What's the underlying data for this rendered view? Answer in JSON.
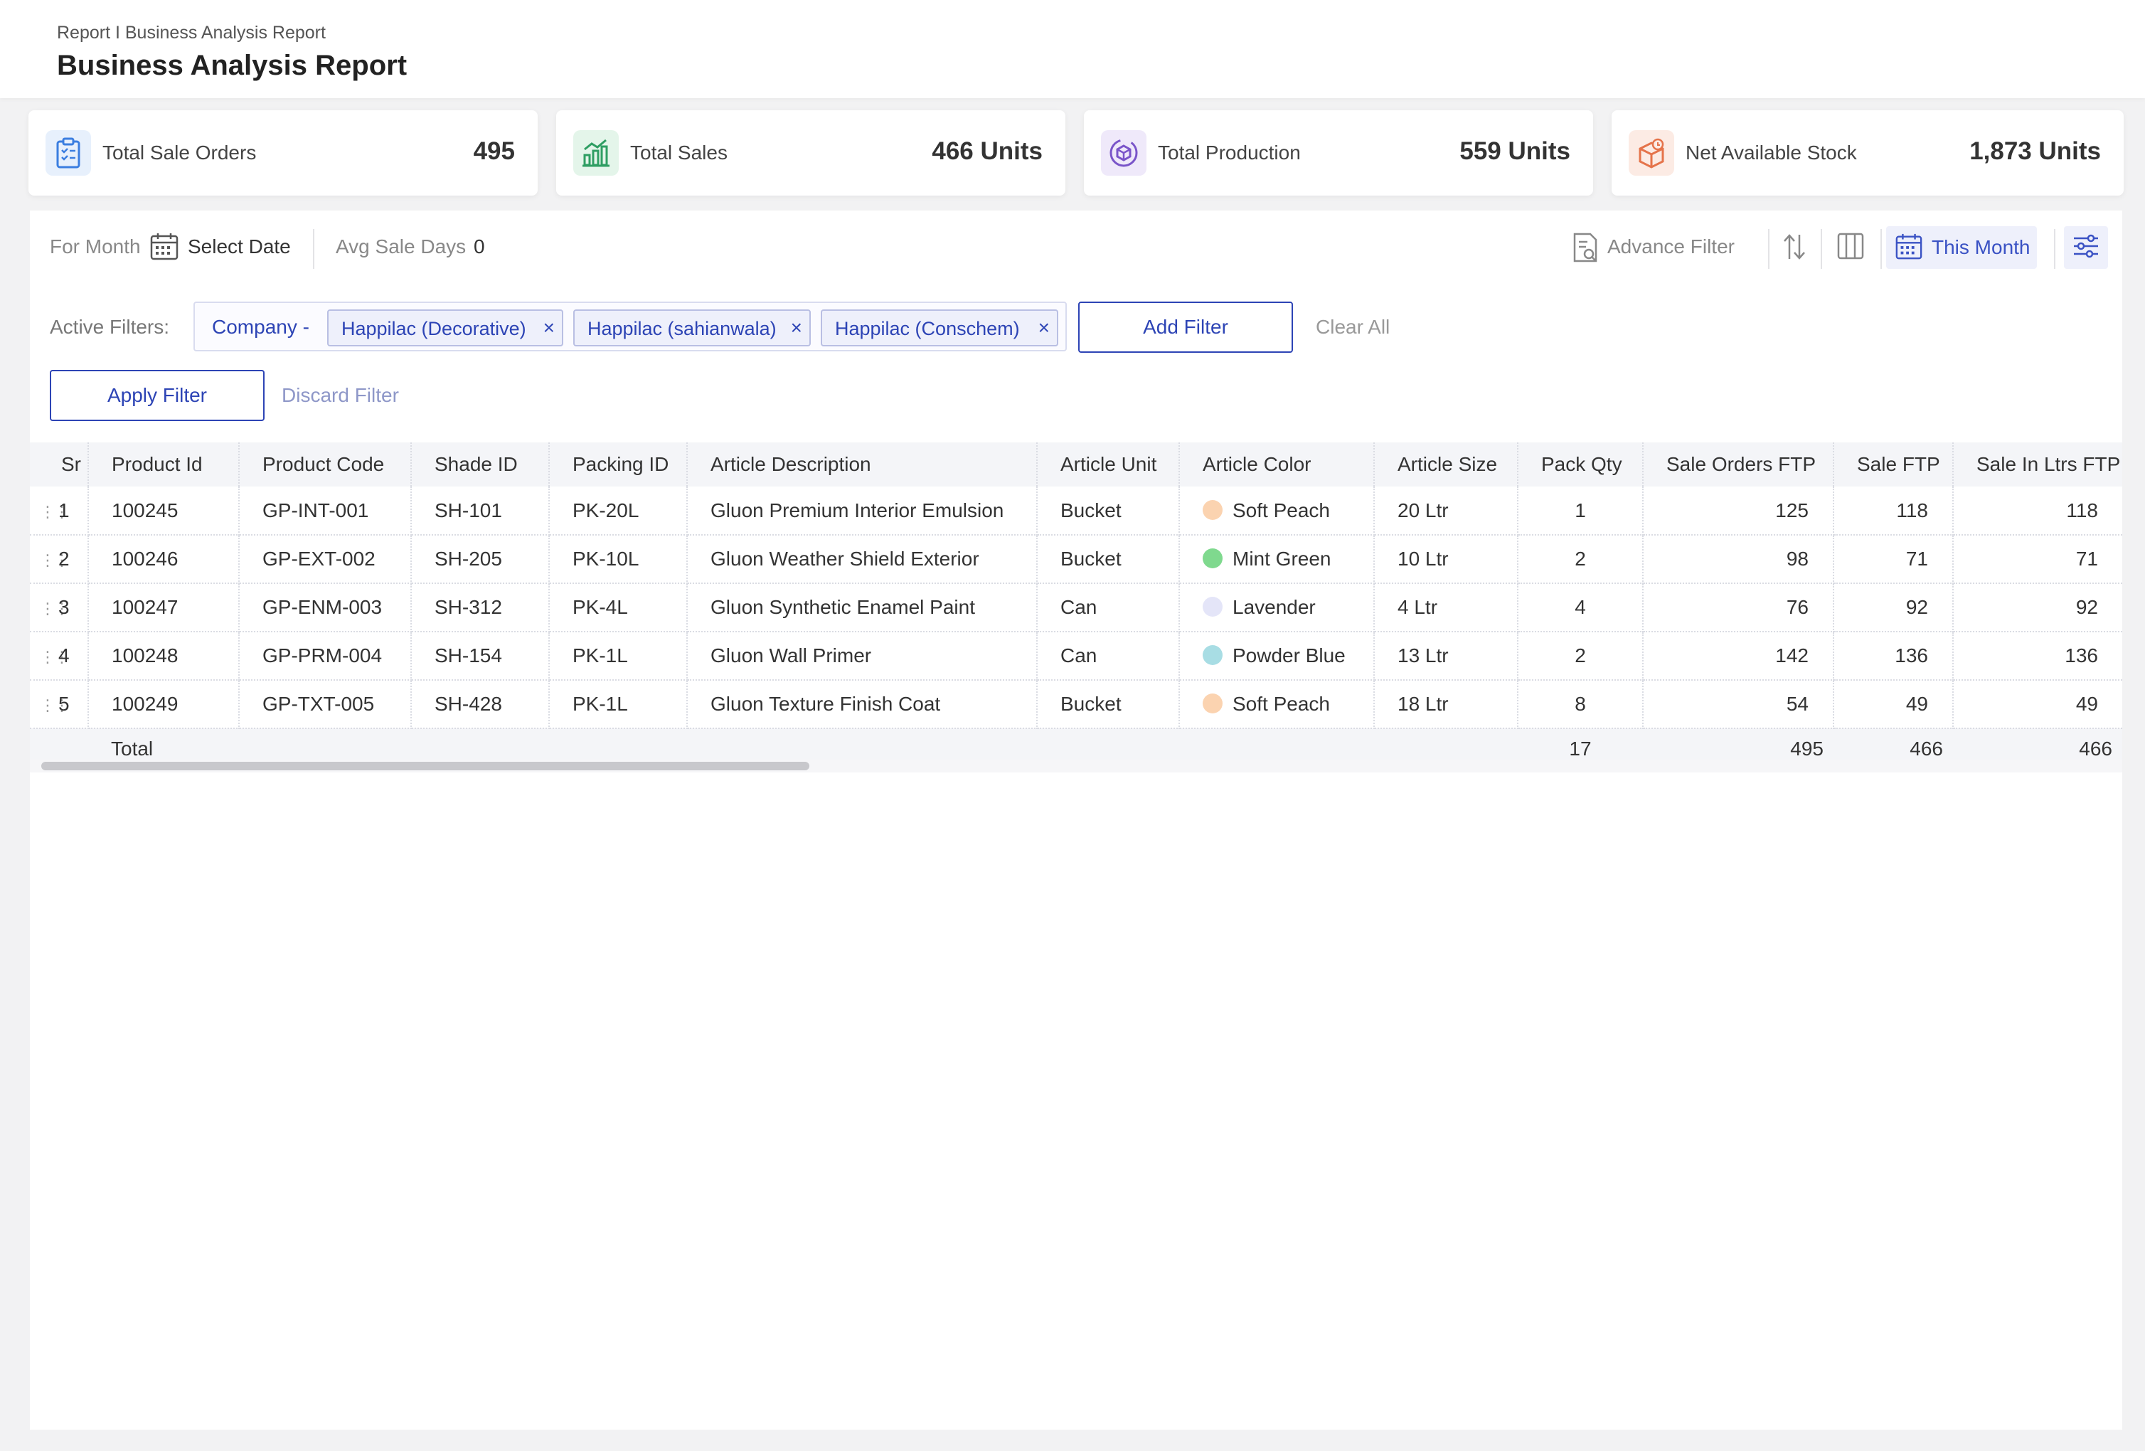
{
  "header": {
    "breadcrumb": "Report I Business Analysis Report",
    "title": "Business Analysis Report"
  },
  "stats": [
    {
      "label": "Total Sale Orders",
      "value": "495",
      "icon": "clipboard-icon",
      "color": "#3b7ee0"
    },
    {
      "label": "Total Sales",
      "value": "466 Units",
      "icon": "bar-chart-icon",
      "color": "#2f9e63"
    },
    {
      "label": "Total Production",
      "value": "559 Units",
      "icon": "production-cube-icon",
      "color": "#7a55c9"
    },
    {
      "label": "Net Available Stock",
      "value": "1,873 Units",
      "icon": "stock-box-icon",
      "color": "#e5734a"
    }
  ],
  "toolbar": {
    "for_month_label": "For Month",
    "select_date": "Select Date",
    "avg_sale_days_label": "Avg Sale Days",
    "avg_sale_days_value": "0",
    "advance_filter": "Advance Filter",
    "this_month": "This Month"
  },
  "filters": {
    "active_label": "Active Filters:",
    "group_prefix": "Company -",
    "chips": [
      "Happilac (Decorative)",
      "Happilac (sahianwala)",
      "Happilac (Conschem)"
    ],
    "add_filter": "Add Filter",
    "clear_all": "Clear All",
    "apply_filter": "Apply Filter",
    "discard_filter": "Discard Filter"
  },
  "table": {
    "columns": [
      "Sr",
      "Product Id",
      "Product Code",
      "Shade ID",
      "Packing ID",
      "Article Description",
      "Article Unit",
      "Article Color",
      "Article Size",
      "Pack Qty",
      "Sale Orders FTP",
      "Sale FTP",
      "Sale In Ltrs FTP"
    ],
    "rows": [
      {
        "sr": "1",
        "product_id": "100245",
        "product_code": "GP-INT-001",
        "shade_id": "SH-101",
        "packing_id": "PK-20L",
        "description": "Gluon Premium Interior Emulsion",
        "unit": "Bucket",
        "color_name": "Soft Peach",
        "color_hex": "#fbd3b0",
        "size": "20 Ltr",
        "pack_qty": "1",
        "sale_orders_ftp": "125",
        "sale_ftp": "118",
        "sale_ltrs_ftp": "118"
      },
      {
        "sr": "2",
        "product_id": "100246",
        "product_code": "GP-EXT-002",
        "shade_id": "SH-205",
        "packing_id": "PK-10L",
        "description": "Gluon Weather Shield Exterior",
        "unit": "Bucket",
        "color_name": "Mint Green",
        "color_hex": "#7fd98e",
        "size": "10 Ltr",
        "pack_qty": "2",
        "sale_orders_ftp": "98",
        "sale_ftp": "71",
        "sale_ltrs_ftp": "71"
      },
      {
        "sr": "3",
        "product_id": "100247",
        "product_code": "GP-ENM-003",
        "shade_id": "SH-312",
        "packing_id": "PK-4L",
        "description": "Gluon Synthetic Enamel Paint",
        "unit": "Can",
        "color_name": "Lavender",
        "color_hex": "#e4e5f8",
        "size": "4 Ltr",
        "pack_qty": "4",
        "sale_orders_ftp": "76",
        "sale_ftp": "92",
        "sale_ltrs_ftp": "92"
      },
      {
        "sr": "4",
        "product_id": "100248",
        "product_code": "GP-PRM-004",
        "shade_id": "SH-154",
        "packing_id": "PK-1L",
        "description": "Gluon Wall Primer",
        "unit": "Can",
        "color_name": "Powder Blue",
        "color_hex": "#a8dde4",
        "size": "13 Ltr",
        "pack_qty": "2",
        "sale_orders_ftp": "142",
        "sale_ftp": "136",
        "sale_ltrs_ftp": "136"
      },
      {
        "sr": "5",
        "product_id": "100249",
        "product_code": "GP-TXT-005",
        "shade_id": "SH-428",
        "packing_id": "PK-1L",
        "description": "Gluon Texture Finish Coat",
        "unit": "Bucket",
        "color_name": "Soft Peach",
        "color_hex": "#fbd3b0",
        "size": "18 Ltr",
        "pack_qty": "8",
        "sale_orders_ftp": "54",
        "sale_ftp": "49",
        "sale_ltrs_ftp": "49"
      }
    ],
    "total": {
      "label": "Total",
      "pack_qty": "17",
      "sale_orders_ftp": "495",
      "sale_ftp": "466",
      "sale_ltrs_ftp": "466"
    }
  }
}
